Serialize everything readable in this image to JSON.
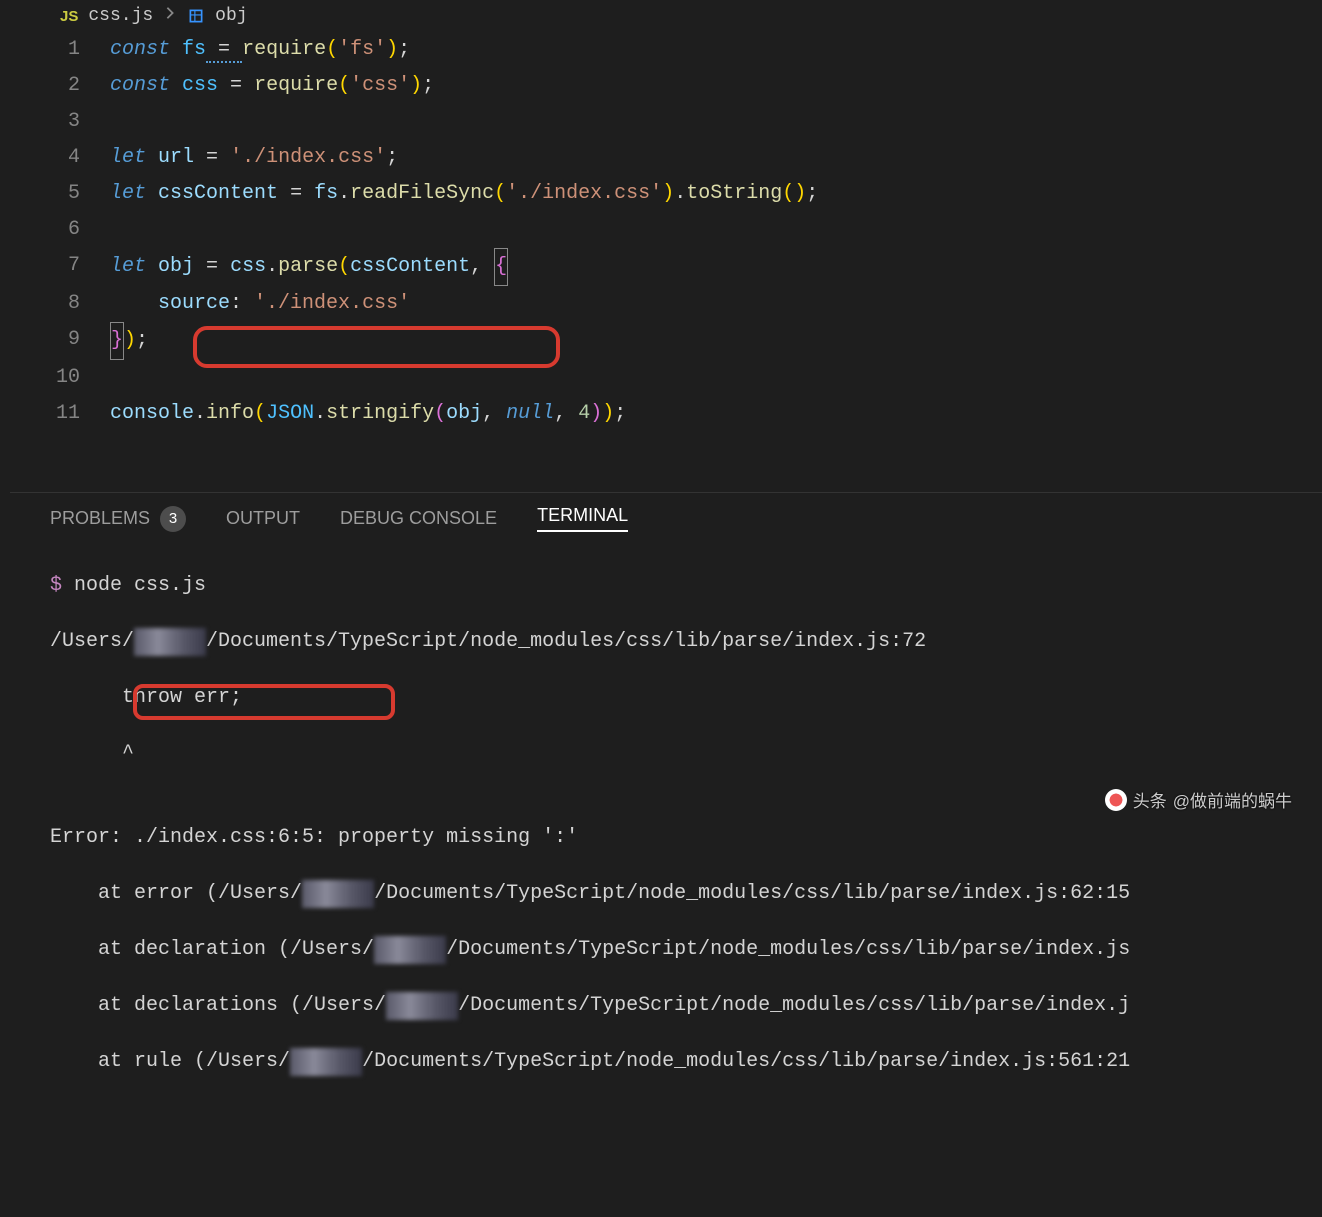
{
  "breadcrumbs": {
    "js_badge": "JS",
    "file": "css.js",
    "symbol": "obj"
  },
  "editor": {
    "lines": [
      {
        "n": "1"
      },
      {
        "n": "2"
      },
      {
        "n": "3"
      },
      {
        "n": "4"
      },
      {
        "n": "5"
      },
      {
        "n": "6"
      },
      {
        "n": "7"
      },
      {
        "n": "8"
      },
      {
        "n": "9"
      },
      {
        "n": "10"
      },
      {
        "n": "11"
      }
    ],
    "tokens": {
      "const": "const",
      "let": "let",
      "fs": "fs",
      "css": "css",
      "url": "url",
      "cssContent": "cssContent",
      "obj": "obj",
      "require": "require",
      "readFileSync": "readFileSync",
      "toString": "toString",
      "parse": "parse",
      "console": "console",
      "info": "info",
      "JSON": "JSON",
      "stringify": "stringify",
      "source": "source",
      "null": "null",
      "four": "4",
      "eq": " = ",
      "semi": ";",
      "lparen": "(",
      "rparen": ")",
      "lbrace": "{",
      "rbrace": "}",
      "lbrace_end": "});",
      "dot": ".",
      "comma": ", ",
      "str_fs": "'fs'",
      "str_css": "'css'",
      "str_indexcss": "'./index.css'",
      "colon": ": "
    }
  },
  "panel": {
    "tabs": {
      "problems": "PROBLEMS",
      "problems_badge": "3",
      "output": "OUTPUT",
      "debug": "DEBUG CONSOLE",
      "terminal": "TERMINAL"
    }
  },
  "terminal": {
    "prompt": "$",
    "cmd": " node css.js",
    "line2a": "/Users/",
    "line2b": "/Documents/TypeScript/node_modules/css/lib/parse/index.js:72",
    "line3": "      throw err;",
    "line4": "      ^",
    "blank": "",
    "err_prefix": "Error: ",
    "err_loc": "./index.css:6:5:",
    "err_msg": " property missing ':'",
    "stk1a": "    at error (/Users/",
    "stk1b": "/Documents/TypeScript/node_modules/css/lib/parse/index.js:62:15",
    "stk2a": "    at declaration (/Users/",
    "stk2b": "/Documents/TypeScript/node_modules/css/lib/parse/index.js",
    "stk3a": "    at declarations (/Users/",
    "stk3b": "/Documents/TypeScript/node_modules/css/lib/parse/index.j",
    "stk4a": "    at rule (/Users/",
    "stk4b": "/Documents/TypeScript/node_modules/css/lib/parse/index.js:561:21"
  },
  "watermark": {
    "prefix": "头条",
    "text": "@做前端的蜗牛"
  }
}
